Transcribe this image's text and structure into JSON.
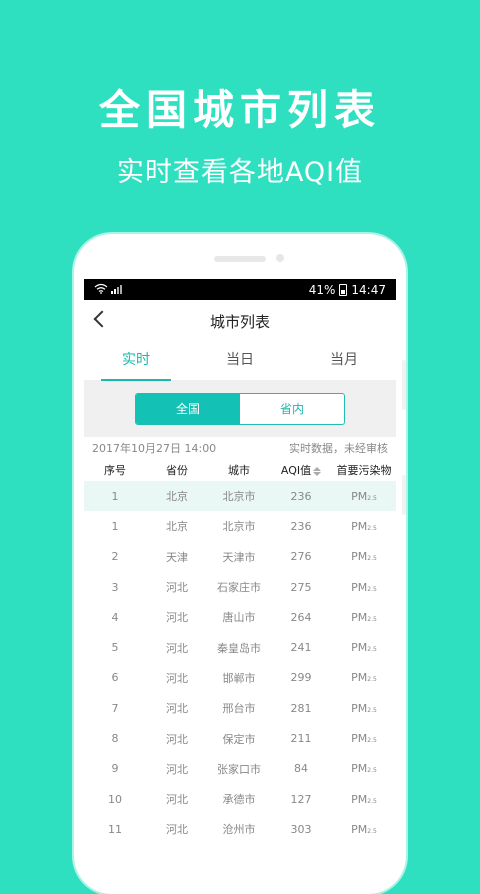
{
  "promo": {
    "title": "全国城市列表",
    "subtitle": "实时查看各地AQI值"
  },
  "status_bar": {
    "battery": "41%",
    "time": "14:47"
  },
  "nav": {
    "title": "城市列表"
  },
  "tabs": [
    {
      "label": "实时",
      "active": true
    },
    {
      "label": "当日",
      "active": false
    },
    {
      "label": "当月",
      "active": false
    }
  ],
  "segment": {
    "national": "全国",
    "province": "省内"
  },
  "info": {
    "datetime": "2017年10月27日 14:00",
    "note": "实时数据，未经审核"
  },
  "table": {
    "headers": [
      "序号",
      "省份",
      "城市",
      "AQI值",
      "首要污染物"
    ],
    "rows": [
      {
        "idx": "1",
        "province": "北京",
        "city": "北京市",
        "aqi": "236",
        "pollutant": "PM",
        "sub": "2.5"
      },
      {
        "idx": "1",
        "province": "北京",
        "city": "北京市",
        "aqi": "236",
        "pollutant": "PM",
        "sub": "2.5"
      },
      {
        "idx": "2",
        "province": "天津",
        "city": "天津市",
        "aqi": "276",
        "pollutant": "PM",
        "sub": "2.5"
      },
      {
        "idx": "3",
        "province": "河北",
        "city": "石家庄市",
        "aqi": "275",
        "pollutant": "PM",
        "sub": "2.5"
      },
      {
        "idx": "4",
        "province": "河北",
        "city": "唐山市",
        "aqi": "264",
        "pollutant": "PM",
        "sub": "2.5"
      },
      {
        "idx": "5",
        "province": "河北",
        "city": "秦皇岛市",
        "aqi": "241",
        "pollutant": "PM",
        "sub": "2.5"
      },
      {
        "idx": "6",
        "province": "河北",
        "city": "邯郸市",
        "aqi": "299",
        "pollutant": "PM",
        "sub": "2.5"
      },
      {
        "idx": "7",
        "province": "河北",
        "city": "邢台市",
        "aqi": "281",
        "pollutant": "PM",
        "sub": "2.5"
      },
      {
        "idx": "8",
        "province": "河北",
        "city": "保定市",
        "aqi": "211",
        "pollutant": "PM",
        "sub": "2.5"
      },
      {
        "idx": "9",
        "province": "河北",
        "city": "张家口市",
        "aqi": "84",
        "pollutant": "PM",
        "sub": "2.5"
      },
      {
        "idx": "10",
        "province": "河北",
        "city": "承德市",
        "aqi": "127",
        "pollutant": "PM",
        "sub": "2.5"
      },
      {
        "idx": "11",
        "province": "河北",
        "city": "沧州市",
        "aqi": "303",
        "pollutant": "PM",
        "sub": "2.5"
      }
    ]
  },
  "colors": {
    "background": "#2fe0c0",
    "accent": "#13c2b5"
  }
}
